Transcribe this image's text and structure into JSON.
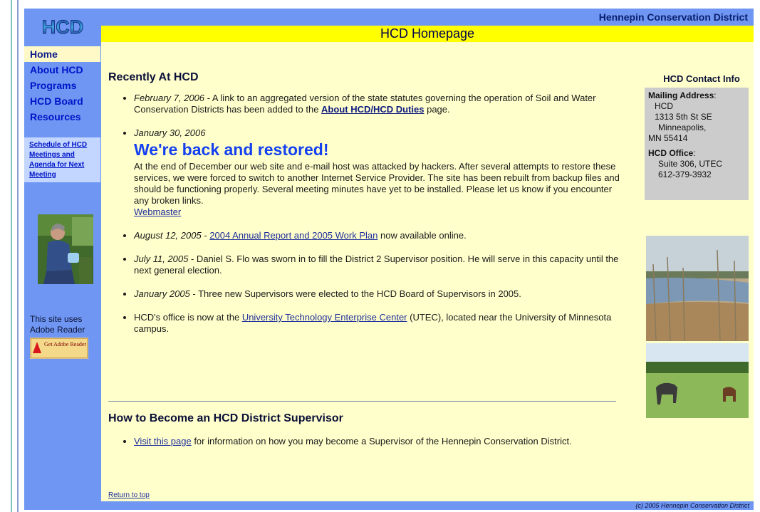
{
  "header": {
    "logo_text": "HCD",
    "site_name": "Hennepin Conservation District",
    "page_title": "HCD Homepage"
  },
  "nav": {
    "items": [
      {
        "label": "Home"
      },
      {
        "label": "About HCD"
      },
      {
        "label": "Programs"
      },
      {
        "label": "HCD Board"
      },
      {
        "label": "Resources"
      }
    ],
    "schedule_link": "Schedule of HCD Meetings and Agenda for Next Meeting"
  },
  "sidebar": {
    "reader_text": "This site uses Adobe Reader",
    "reader_badge_text": "Get Adobe Reader"
  },
  "main": {
    "recent_title": "Recently At HCD",
    "news": [
      {
        "date": "February 7, 2006",
        "text_before": " - A link to an aggregated version of the state statutes governing the operation of Soil and Water Conservation Districts has been added to the ",
        "link": "About HCD/HCD Duties",
        "text_after": " page."
      },
      {
        "date": "January 30, 2006",
        "headline": "We're back and restored!",
        "body": "At the end of December our web site and e-mail host was attacked by hackers. After several attempts to restore these services, we were forced to switch to another Internet Service Provider. The site has been rebuilt from backup files and should be functioning properly. Several meeting minutes have yet to be installed. Please let us know if you encounter any broken links.",
        "link": "Webmaster"
      },
      {
        "date": "August 12, 2005",
        "text_before": " - ",
        "link": "2004 Annual Report and 2005 Work Plan",
        "text_after": " now available online."
      },
      {
        "date": "July 11, 2005",
        "text_before": " - Daniel S. Flo was sworn in to fill the District 2 Supervisor position. He will serve in this capacity until the next general election."
      },
      {
        "date": "January 2005",
        "text_before": " - Three new Supervisors were elected to the HCD Board of Supervisors in 2005."
      },
      {
        "text_before": "HCD's office is now at the ",
        "link": "University Technology Enterprise Center",
        "text_after": " (UTEC), located near the University of Minnesota campus."
      }
    ],
    "supervisor_title": "How to Become an HCD District Supervisor",
    "supervisor_link": "Visit this page",
    "supervisor_text": " for information on how you may become a Supervisor of the Hennepin Conservation District.",
    "return_to_top": "Return to top"
  },
  "contact": {
    "title": "HCD Contact Info",
    "mailing_label": "Mailing Address",
    "mailing_lines": [
      "HCD",
      "1313 5th St SE",
      "Minneapolis,",
      "MN 55414"
    ],
    "office_label": "HCD Office",
    "office_lines": [
      "Suite 306, UTEC",
      "612-379-3932"
    ]
  },
  "footer": {
    "copyright": "(c) 2005 Hennepin Conservation District"
  },
  "colors": {
    "page_background": "#ffffcc",
    "frame_blue": "#6e96f2",
    "title_bar_yellow": "#ffff00",
    "nav_link_blue": "#0015c8",
    "headline_blue": "#1440f0",
    "contact_box_gray": "#cccccc"
  }
}
